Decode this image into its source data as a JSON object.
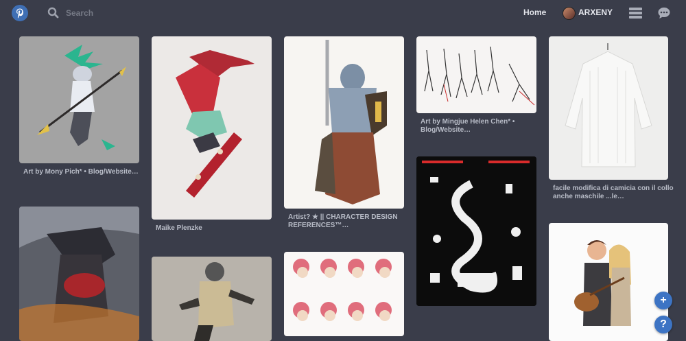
{
  "header": {
    "logo": "pinterest-logo",
    "search": {
      "placeholder": "Search",
      "value": ""
    },
    "home_label": "Home",
    "user_name": "ARXENY",
    "icons": [
      "search-icon",
      "menu-icon",
      "chat-icon"
    ]
  },
  "pins": [
    {
      "caption": "Art by Mony Pich* • Blog/Website…",
      "background": "#a3a3a3"
    },
    {
      "caption": "Maike Plenzke",
      "background": "#ece9e7"
    },
    {
      "caption": "Artist? ★ || CHARACTER DESIGN REFERENCES™…",
      "background": "#f7f5f2"
    },
    {
      "caption": "Art by Mingjue Helen Chen* • Blog/Website…",
      "background": "#f6f4f3"
    },
    {
      "caption": "facile modifica di camicia con il collo anche maschile ...le…",
      "background": "#eeeeed"
    },
    {
      "caption": "",
      "background": "#6a6a70"
    },
    {
      "caption": "",
      "background": "#b5b0a8"
    },
    {
      "caption": "",
      "background": "#faf8f7"
    },
    {
      "caption": "",
      "background": "#0c0c0c"
    },
    {
      "caption": "",
      "background": "#fbfbfb"
    }
  ],
  "fab": {
    "add_label": "+",
    "help_label": "?"
  }
}
